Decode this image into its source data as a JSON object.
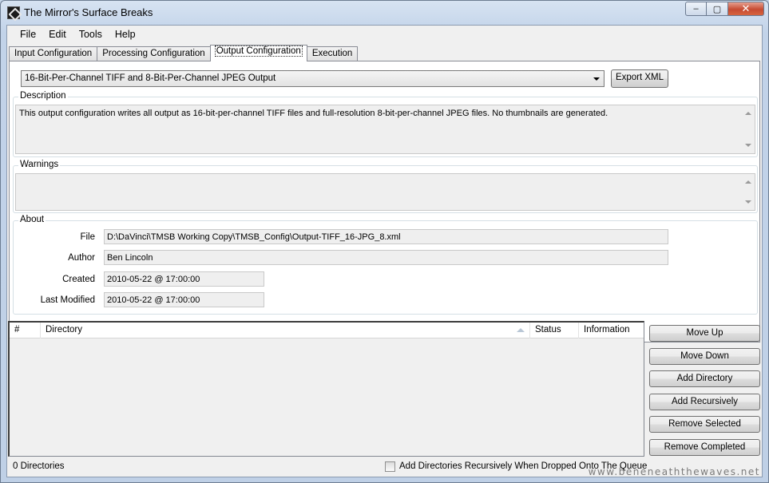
{
  "window": {
    "title": "The Mirror's Surface Breaks",
    "controls": {
      "minimize": "‒",
      "maximize": "▢",
      "close": "✕"
    }
  },
  "menu": [
    "File",
    "Edit",
    "Tools",
    "Help"
  ],
  "tabs": [
    "Input Configuration",
    "Processing Configuration",
    "Output Configuration",
    "Execution"
  ],
  "active_tab": "Output Configuration",
  "output": {
    "selected_configuration": "16-Bit-Per-Channel TIFF and 8-Bit-Per-Channel JPEG Output",
    "export_label": "Export XML"
  },
  "description": {
    "legend": "Description",
    "text": "This output configuration writes all output as 16-bit-per-channel TIFF files and full-resolution 8-bit-per-channel JPEG files. No thumbnails are generated."
  },
  "warnings": {
    "legend": "Warnings",
    "text": ""
  },
  "about": {
    "legend": "About",
    "file_label": "File",
    "file_value": "D:\\DaVinci\\TMSB Working Copy\\TMSB_Config\\Output-TIFF_16-JPG_8.xml",
    "author_label": "Author",
    "author_value": "Ben Lincoln",
    "created_label": "Created",
    "created_value": "2010-05-22 @ 17:00:00",
    "modified_label": "Last Modified",
    "modified_value": "2010-05-22 @ 17:00:00"
  },
  "directory_list": {
    "columns": [
      "#",
      "Directory",
      "Status",
      "Information"
    ],
    "rows": []
  },
  "side_buttons": [
    "Move Up",
    "Move Down",
    "Add Directory",
    "Add Recursively",
    "Remove Selected",
    "Remove Completed"
  ],
  "status": {
    "count": "0 Directories",
    "checkbox_label": "Add Directories Recursively When Dropped Onto The Queue",
    "checkbox_checked": false
  },
  "watermark": "www.beneneaththewaves.net",
  "colors": {
    "frame": "#c2d3e9",
    "close_button": "#c74b32",
    "panel": "#f0f0f0"
  }
}
